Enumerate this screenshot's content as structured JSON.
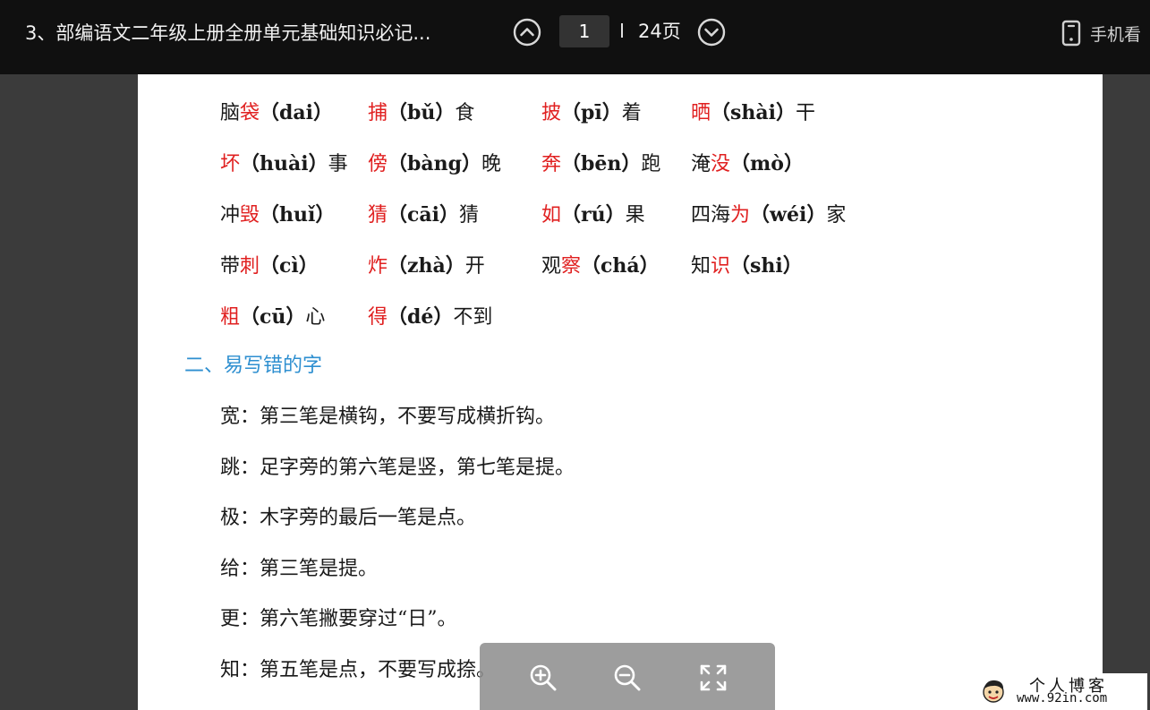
{
  "toolbar": {
    "doc_title": "3、部编语文二年级上册全册单元基础知识必记...",
    "prev_icon": "chevron-up-circle-icon",
    "next_icon": "chevron-down-circle-icon",
    "current_page": "1",
    "total_pages": "24页",
    "mobile_icon": "phone-icon",
    "mobile_label": "手机看"
  },
  "document": {
    "words": [
      [
        {
          "pre": "脑",
          "red": "袋",
          "pin": "（dai）",
          "post": ""
        },
        {
          "pre": "",
          "red": "捕",
          "pin": "（bǔ）",
          "post": "食"
        },
        {
          "pre": "",
          "red": "披",
          "pin": "（pī）",
          "post": "着"
        },
        {
          "pre": "",
          "red": "晒",
          "pin": "（shài）",
          "post": "干"
        }
      ],
      [
        {
          "pre": "",
          "red": "坏",
          "pin": "（huài）",
          "post": "事"
        },
        {
          "pre": "",
          "red": "傍",
          "pin": "（bàng）",
          "post": "晚"
        },
        {
          "pre": "",
          "red": "奔",
          "pin": "（bēn）",
          "post": "跑"
        },
        {
          "pre": "淹",
          "red": "没",
          "pin": "（mò）",
          "post": ""
        }
      ],
      [
        {
          "pre": "冲",
          "red": "毁",
          "pin": "（huǐ）",
          "post": ""
        },
        {
          "pre": "",
          "red": "猜",
          "pin": "（cāi）",
          "post": "猜"
        },
        {
          "pre": "",
          "red": "如",
          "pin": "（rú）",
          "post": "果"
        },
        {
          "pre": "四海",
          "red": "为",
          "pin": "（wéi）",
          "post": "家"
        }
      ],
      [
        {
          "pre": "带",
          "red": "刺",
          "pin": "（cì）",
          "post": ""
        },
        {
          "pre": "",
          "red": "炸",
          "pin": "（zhà）",
          "post": "开"
        },
        {
          "pre": "观",
          "red": "察",
          "pin": "（chá）",
          "post": ""
        },
        {
          "pre": "知",
          "red": "识",
          "pin": "（shi）",
          "post": ""
        }
      ],
      [
        {
          "pre": "",
          "red": "粗",
          "pin": "（cū）",
          "post": "心"
        },
        {
          "pre": "",
          "red": "得",
          "pin": "（dé）",
          "post": "不到"
        }
      ]
    ],
    "section_heading": "二、易写错的字",
    "notes": [
      "宽：第三笔是横钩，不要写成横折钩。",
      "跳：足字旁的第六笔是竖，第七笔是提。",
      "极：木字旁的最后一笔是点。",
      "给：第三笔是提。",
      "更：第六笔撇要穿过“日”。",
      "知：第五笔是点，不要写成捺。"
    ]
  },
  "zoom": {
    "zoom_in_icon": "zoom-in-icon",
    "zoom_out_icon": "zoom-out-icon",
    "fullscreen_icon": "fullscreen-icon"
  },
  "watermark": {
    "line1": "个人博客",
    "line2": "www.92in.com"
  },
  "colors": {
    "topbar_bg": "#101010",
    "viewer_bg": "#3b3b3b",
    "highlight_red": "#e02020",
    "heading_blue": "#2e8fd0"
  }
}
